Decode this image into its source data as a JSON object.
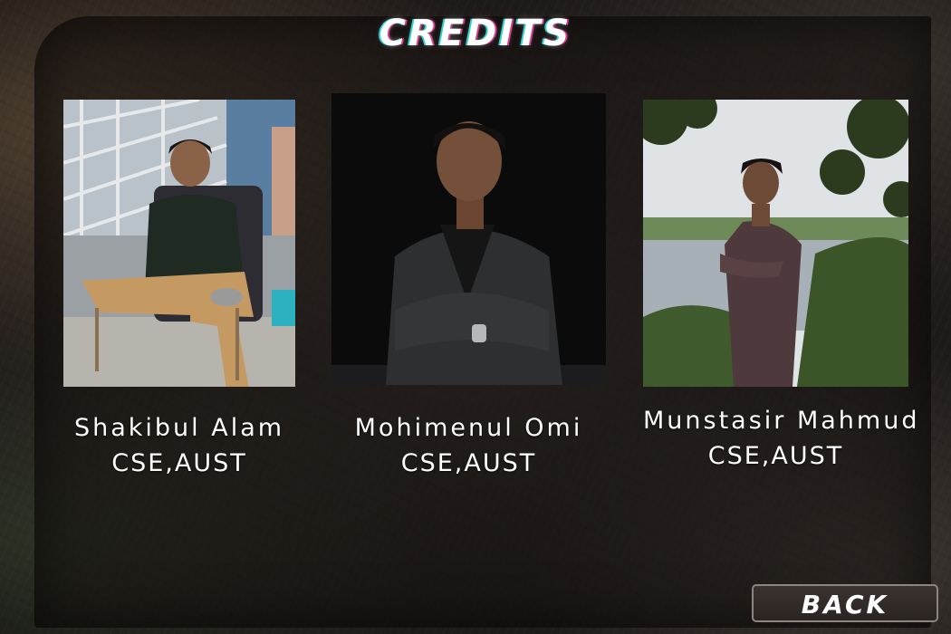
{
  "screen": {
    "title": "CREDITS"
  },
  "credits": [
    {
      "name": "Shakibul Alam",
      "affiliation": "CSE,AUST"
    },
    {
      "name": "Mohimenul Omi",
      "affiliation": "CSE,AUST"
    },
    {
      "name": "Munstasir Mahmud",
      "affiliation": "CSE,AUST"
    }
  ],
  "buttons": {
    "back_label": "BACK"
  }
}
